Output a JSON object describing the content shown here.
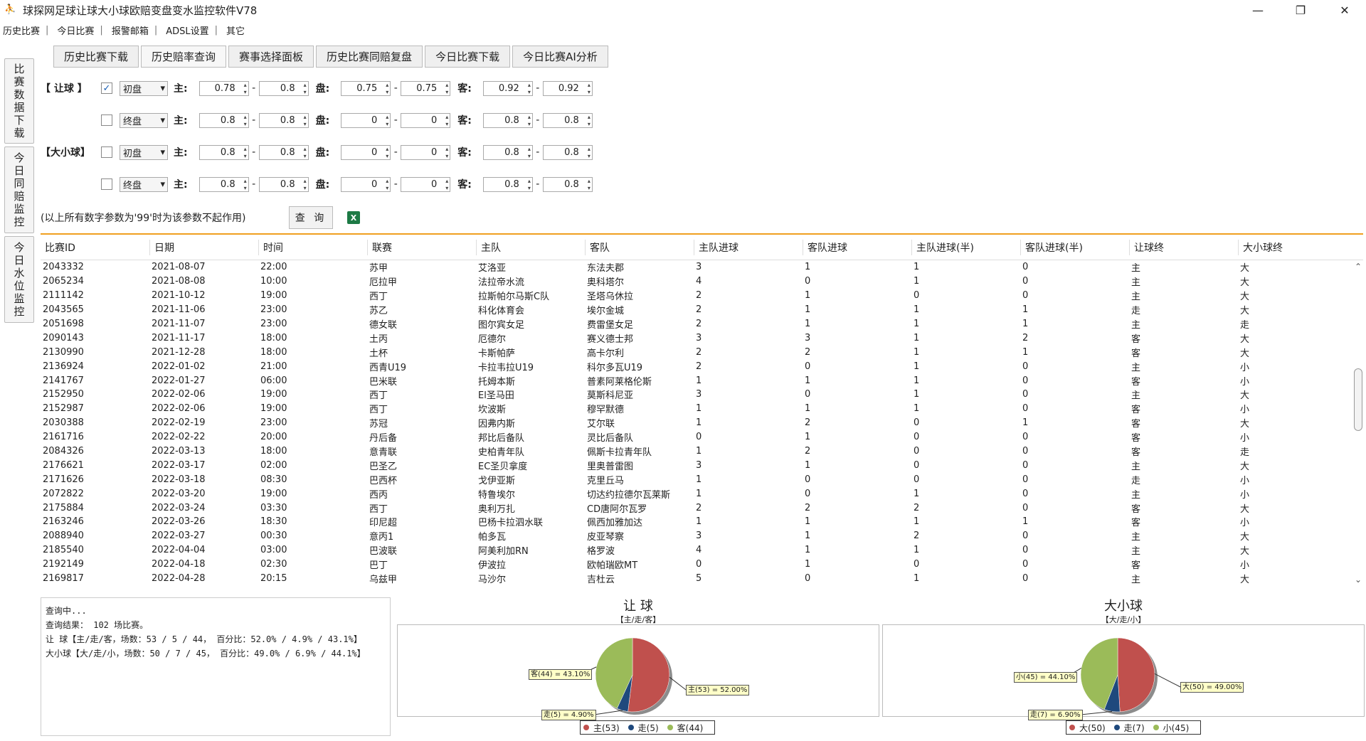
{
  "window": {
    "title": "球探网足球让球大小球欧赔变盘变水监控软件V78",
    "min": "—",
    "max": "❐",
    "close": "✕"
  },
  "menu": [
    "历史比赛",
    "今日比赛",
    "报警邮箱",
    "ADSL设置",
    "其它"
  ],
  "side_tabs": [
    "比赛数据下载",
    "今日同赔监控",
    "今日水位监控"
  ],
  "tabs": [
    "历史比赛下载",
    "历史赔率查询",
    "赛事选择面板",
    "历史比赛同赔复盘",
    "今日比赛下载",
    "今日比赛AI分析"
  ],
  "form": {
    "labels": {
      "handicap": "【 让球 】",
      "ou": "【大小球】",
      "home": "主:",
      "line": "盘:",
      "away": "客:",
      "dash": "-"
    },
    "rows": [
      {
        "section": "handicap",
        "checked": true,
        "mode": "初盘",
        "v": [
          "0.78",
          "0.8",
          "0.75",
          "0.75",
          "0.92",
          "0.92"
        ]
      },
      {
        "section": "",
        "checked": false,
        "mode": "终盘",
        "v": [
          "0.8",
          "0.8",
          "0",
          "0",
          "0.8",
          "0.8"
        ]
      },
      {
        "section": "ou",
        "checked": false,
        "mode": "初盘",
        "v": [
          "0.8",
          "0.8",
          "0",
          "0",
          "0.8",
          "0.8"
        ]
      },
      {
        "section": "",
        "checked": false,
        "mode": "终盘",
        "v": [
          "0.8",
          "0.8",
          "0",
          "0",
          "0.8",
          "0.8"
        ]
      }
    ],
    "note": "(以上所有数字参数为'99'时为该参数不起作用)",
    "query": "查 询",
    "excel": "X"
  },
  "table": {
    "headers": [
      "比赛ID",
      "日期",
      "时间",
      "联赛",
      "主队",
      "客队",
      "主队进球",
      "客队进球",
      "主队进球(半)",
      "客队进球(半)",
      "让球终",
      "大小球终"
    ],
    "rows": [
      [
        "2043332",
        "2021-08-07",
        "22:00",
        "苏甲",
        "艾洛亚",
        "东法夫郡",
        "3",
        "1",
        "1",
        "0",
        "主",
        "大"
      ],
      [
        "2065234",
        "2021-08-08",
        "10:00",
        "厄拉甲",
        "法拉帝水流",
        "奥科塔尔",
        "4",
        "0",
        "1",
        "0",
        "主",
        "大"
      ],
      [
        "2111142",
        "2021-10-12",
        "19:00",
        "西丁",
        "拉斯帕尔马斯C队",
        "圣塔乌休拉",
        "2",
        "1",
        "0",
        "0",
        "主",
        "大"
      ],
      [
        "2043565",
        "2021-11-06",
        "23:00",
        "苏乙",
        "科化体育会",
        "埃尔金城",
        "2",
        "1",
        "1",
        "1",
        "走",
        "大"
      ],
      [
        "2051698",
        "2021-11-07",
        "23:00",
        "德女联",
        "图尔宾女足",
        "费雷堡女足",
        "2",
        "1",
        "1",
        "1",
        "主",
        "走"
      ],
      [
        "2090143",
        "2021-11-17",
        "18:00",
        "土丙",
        "厄德尔",
        "赛义德士邦",
        "3",
        "3",
        "1",
        "2",
        "客",
        "大"
      ],
      [
        "2130990",
        "2021-12-28",
        "18:00",
        "土杯",
        "卡斯帕萨",
        "高卡尔利",
        "2",
        "2",
        "1",
        "1",
        "客",
        "大"
      ],
      [
        "2136924",
        "2022-01-02",
        "21:00",
        "西青U19",
        "卡拉韦拉U19",
        "科尔多瓦U19",
        "2",
        "0",
        "1",
        "0",
        "主",
        "小"
      ],
      [
        "2141767",
        "2022-01-27",
        "06:00",
        "巴米联",
        "托姆本斯",
        "普素阿莱格伦斯",
        "1",
        "1",
        "1",
        "0",
        "客",
        "小"
      ],
      [
        "2152950",
        "2022-02-06",
        "19:00",
        "西丁",
        "El圣马田",
        "莫斯科尼亚",
        "3",
        "0",
        "1",
        "0",
        "主",
        "大"
      ],
      [
        "2152987",
        "2022-02-06",
        "19:00",
        "西丁",
        "坎波斯",
        "穆罕默德",
        "1",
        "1",
        "1",
        "0",
        "客",
        "小"
      ],
      [
        "2030388",
        "2022-02-19",
        "23:00",
        "苏冠",
        "因弗内斯",
        "艾尔联",
        "1",
        "2",
        "0",
        "1",
        "客",
        "大"
      ],
      [
        "2161716",
        "2022-02-22",
        "20:00",
        "丹后备",
        "邦比后备队",
        "灵比后备队",
        "0",
        "1",
        "0",
        "0",
        "客",
        "小"
      ],
      [
        "2084326",
        "2022-03-13",
        "18:00",
        "意青联",
        "史柏青年队",
        "佩斯卡拉青年队",
        "1",
        "2",
        "0",
        "0",
        "客",
        "走"
      ],
      [
        "2176621",
        "2022-03-17",
        "02:00",
        "巴圣乙",
        "EC圣贝拿度",
        "里奥普雷图",
        "3",
        "1",
        "0",
        "0",
        "主",
        "大"
      ],
      [
        "2171626",
        "2022-03-18",
        "08:30",
        "巴西杯",
        "戈伊亚斯",
        "克里丘马",
        "1",
        "0",
        "0",
        "0",
        "走",
        "小"
      ],
      [
        "2072822",
        "2022-03-20",
        "19:00",
        "西丙",
        "特鲁埃尔",
        "切达约拉德尔瓦莱斯",
        "1",
        "0",
        "1",
        "0",
        "主",
        "小"
      ],
      [
        "2175884",
        "2022-03-24",
        "03:30",
        "西丁",
        "奥利万扎",
        "CD唐阿尔瓦罗",
        "2",
        "2",
        "2",
        "0",
        "客",
        "大"
      ],
      [
        "2163246",
        "2022-03-26",
        "18:30",
        "印尼超",
        "巴杨卡拉泗水联",
        "佩西加雅加达",
        "1",
        "1",
        "1",
        "1",
        "客",
        "小"
      ],
      [
        "2088940",
        "2022-03-27",
        "00:30",
        "意丙1",
        "帕多瓦",
        "皮亚琴察",
        "3",
        "1",
        "2",
        "0",
        "主",
        "大"
      ],
      [
        "2185540",
        "2022-04-04",
        "03:00",
        "巴波联",
        "阿美利加RN",
        "格罗波",
        "4",
        "1",
        "1",
        "0",
        "主",
        "大"
      ],
      [
        "2192149",
        "2022-04-18",
        "02:30",
        "巴丁",
        "伊波拉",
        "欧帕瑞欧MT",
        "0",
        "1",
        "0",
        "0",
        "客",
        "小"
      ],
      [
        "2169817",
        "2022-04-28",
        "20:15",
        "乌兹甲",
        "马沙尔",
        "吉杜云",
        "5",
        "0",
        "1",
        "0",
        "主",
        "大"
      ]
    ]
  },
  "log": [
    "查询中...",
    "查询结果： 102 场比赛。",
    "让  球【主/走/客，场数：53 / 5 / 44，  百分比：52.0% / 4.9% / 43.1%】",
    "大小球【大/走/小，场数：50 / 7 / 45，  百分比：49.0% / 6.9% / 44.1%】"
  ],
  "charts": [
    {
      "title": "让 球",
      "subtitle": "【主/走/客】",
      "slices": [
        {
          "label": "主(53) = 52.00%",
          "legend": "主(53)",
          "value": 53,
          "color": "#c0504d"
        },
        {
          "label": "走(5) = 4.90%",
          "legend": "走(5)",
          "value": 5,
          "color": "#1f497d"
        },
        {
          "label": "客(44) = 43.10%",
          "legend": "客(44)",
          "value": 44,
          "color": "#9bbb59"
        }
      ]
    },
    {
      "title": "大小球",
      "subtitle": "【大/走/小】",
      "slices": [
        {
          "label": "大(50) = 49.00%",
          "legend": "大(50)",
          "value": 50,
          "color": "#c0504d"
        },
        {
          "label": "走(7) = 6.90%",
          "legend": "走(7)",
          "value": 7,
          "color": "#1f497d"
        },
        {
          "label": "小(45) = 44.10%",
          "legend": "小(45)",
          "value": 45,
          "color": "#9bbb59"
        }
      ]
    }
  ],
  "chart_data": [
    {
      "type": "pie",
      "title": "让 球",
      "subtitle": "【主/走/客】",
      "categories": [
        "主(53)",
        "走(5)",
        "客(44)"
      ],
      "values": [
        53,
        5,
        44
      ]
    },
    {
      "type": "pie",
      "title": "大小球",
      "subtitle": "【大/走/小】",
      "categories": [
        "大(50)",
        "走(7)",
        "小(45)"
      ],
      "values": [
        50,
        7,
        45
      ]
    }
  ]
}
